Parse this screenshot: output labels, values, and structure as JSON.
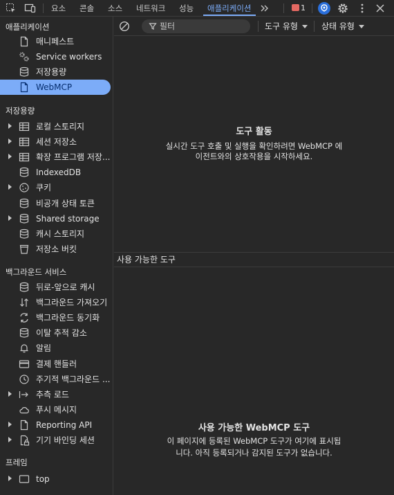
{
  "tabs": [
    "요소",
    "콘솔",
    "소스",
    "네트워크",
    "성능",
    "애플리케이션"
  ],
  "error_count": "1",
  "sidebar": {
    "sections": [
      {
        "title": "애플리케이션",
        "items": [
          {
            "label": "매니페스트",
            "icon": "file-icon"
          },
          {
            "label": "Service workers",
            "icon": "gears-icon"
          },
          {
            "label": "저장용량",
            "icon": "database-icon"
          },
          {
            "label": "WebMCP",
            "icon": "file-icon",
            "selected": true
          }
        ]
      },
      {
        "title": "저장용량",
        "items": [
          {
            "label": "로컬 스토리지",
            "icon": "table-icon",
            "expandable": true
          },
          {
            "label": "세션 저장소",
            "icon": "table-icon",
            "expandable": true
          },
          {
            "label": "확장 프로그램 저장...",
            "icon": "table-icon",
            "expandable": true
          },
          {
            "label": "IndexedDB",
            "icon": "database-icon"
          },
          {
            "label": "쿠키",
            "icon": "cookie-icon",
            "expandable": true
          },
          {
            "label": "비공개 상태 토큰",
            "icon": "database-icon"
          },
          {
            "label": "Shared storage",
            "icon": "database-icon",
            "expandable": true
          },
          {
            "label": "캐시 스토리지",
            "icon": "database-icon"
          },
          {
            "label": "저장소 버킷",
            "icon": "bucket-icon"
          }
        ]
      },
      {
        "title": "백그라운드 서비스",
        "items": [
          {
            "label": "뒤로-앞으로 캐시",
            "icon": "database-icon"
          },
          {
            "label": "백그라운드 가져오기",
            "icon": "fetch-arrows-icon"
          },
          {
            "label": "백그라운드 동기화",
            "icon": "sync-icon"
          },
          {
            "label": "이탈 추적 감소",
            "icon": "database-icon"
          },
          {
            "label": "알림",
            "icon": "bell-icon"
          },
          {
            "label": "결제 핸들러",
            "icon": "card-icon"
          },
          {
            "label": "주기적 백그라운드 ...",
            "icon": "clock-icon"
          },
          {
            "label": "추측 로드",
            "icon": "arrow-bar-icon",
            "expandable": true
          },
          {
            "label": "푸시 메시지",
            "icon": "cloud-icon"
          },
          {
            "label": "Reporting API",
            "icon": "file-icon",
            "expandable": true
          },
          {
            "label": "기기 바인딩 세션",
            "icon": "lock-file-icon",
            "expandable": true
          }
        ]
      },
      {
        "title": "프레임",
        "items": [
          {
            "label": "top",
            "icon": "frame-icon",
            "expandable": true
          }
        ]
      }
    ]
  },
  "toolbar": {
    "filter_placeholder": "필터",
    "tool_type": "도구 유형",
    "status_type": "상태 유형"
  },
  "activity": {
    "title": "도구 활동",
    "desc_line1": "실시간 도구 호출 및 실행을 확인하려면 WebMCP 에",
    "desc_line2": "이전트와의 상호작용을 시작하세요."
  },
  "available": {
    "header": "사용 가능한 도구",
    "title": "사용 가능한 WebMCP 도구",
    "desc_line1": "이 페이지에 등록된 WebMCP 도구가 여기에 표시됩",
    "desc_line2": "니다. 아직 등록되거나 감지된 도구가 없습니다."
  },
  "colors": {
    "background": "#282828",
    "accent": "#7cacf8",
    "error": "#e46962"
  }
}
